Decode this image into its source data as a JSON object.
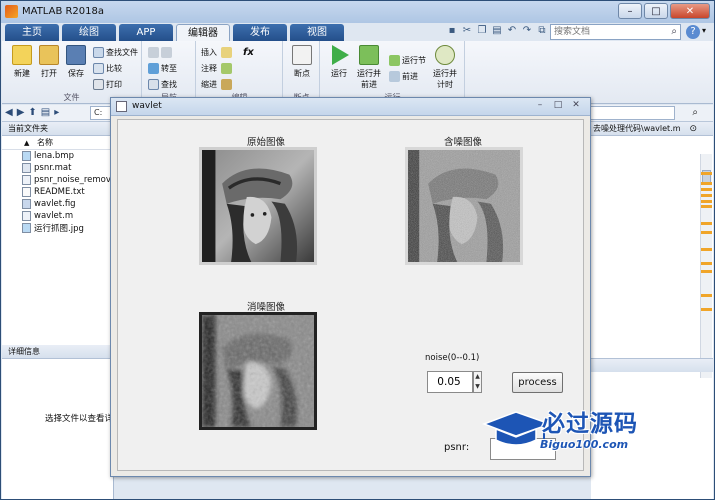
{
  "app": {
    "title": "MATLAB R2018a"
  },
  "tabs": [
    "主页",
    "绘图",
    "APP",
    "编辑器",
    "发布",
    "视图"
  ],
  "search": {
    "placeholder": "搜索文档"
  },
  "ribbon": {
    "file": {
      "new": "新建",
      "open": "打开",
      "save": "保存",
      "find_files": "查找文件",
      "compare": "比较",
      "print": "打印",
      "group": "文件"
    },
    "navigate": {
      "goto": "转至",
      "find": "查找",
      "group": "导航"
    },
    "edit": {
      "insert": "插入",
      "comment": "注释",
      "indent": "缩进",
      "fx": "fx",
      "group": "编辑"
    },
    "breakpoints": {
      "breakpoints": "断点",
      "group": "断点"
    },
    "run": {
      "run": "运行",
      "run_advance": "运行并\n前进",
      "run_section": "运行节",
      "advance": "前进",
      "run_time": "运行并\n计时",
      "group": "运行"
    }
  },
  "address": {
    "path": "C:"
  },
  "current_folder": {
    "title": "当前文件夹",
    "column": "名称",
    "files": [
      "lena.bmp",
      "psnr.mat",
      "psnr_noise_remove...",
      "README.txt",
      "wavlet.fig",
      "wavlet.m",
      "运行抓图.jpg"
    ]
  },
  "details": {
    "title": "详细信息",
    "hint": "选择文件以查看详"
  },
  "editor": {
    "tab_title": "去噪处理代码\\wavlet.m"
  },
  "figure": {
    "title": "wavlet",
    "original_title": "原始图像",
    "noisy_title": "含噪图像",
    "denoised_title": "消噪图像",
    "noise_label": "noise(0--0.1)",
    "noise_value": "0.05",
    "process_label": "process",
    "psnr_label": "psnr:"
  },
  "watermark": {
    "text": "必过源码",
    "url": "Biguo100.com"
  }
}
